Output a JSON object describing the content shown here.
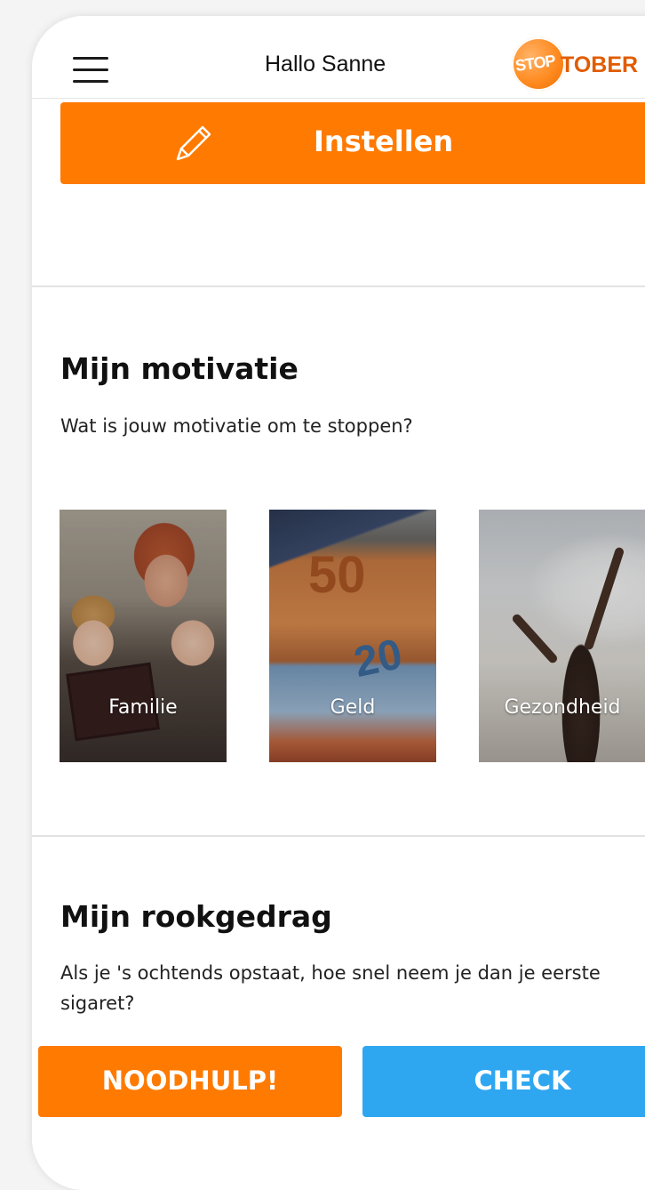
{
  "header": {
    "greeting": "Hallo Sanne",
    "logo_text_left": "STOP",
    "logo_text_right": "TOBER",
    "menu_icon": "hamburger-menu-icon"
  },
  "setup_button": {
    "label": "Instellen",
    "icon": "pencil-icon",
    "color": "#ff7a00"
  },
  "motivation": {
    "title": "Mijn motivatie",
    "question": "Wat is jouw motivatie om te stoppen?",
    "options": [
      {
        "label": "Familie"
      },
      {
        "label": "Geld"
      },
      {
        "label": "Gezondheid"
      }
    ]
  },
  "smoking": {
    "title": "Mijn rookgedrag",
    "question": "Als je 's ochtends opstaat, hoe snel neem je dan je eerste sigaret?"
  },
  "footer": {
    "emergency_label": "NOODHULP!",
    "check_label": "CHECK",
    "emergency_color": "#ff7a00",
    "check_color": "#2fa7f0"
  }
}
